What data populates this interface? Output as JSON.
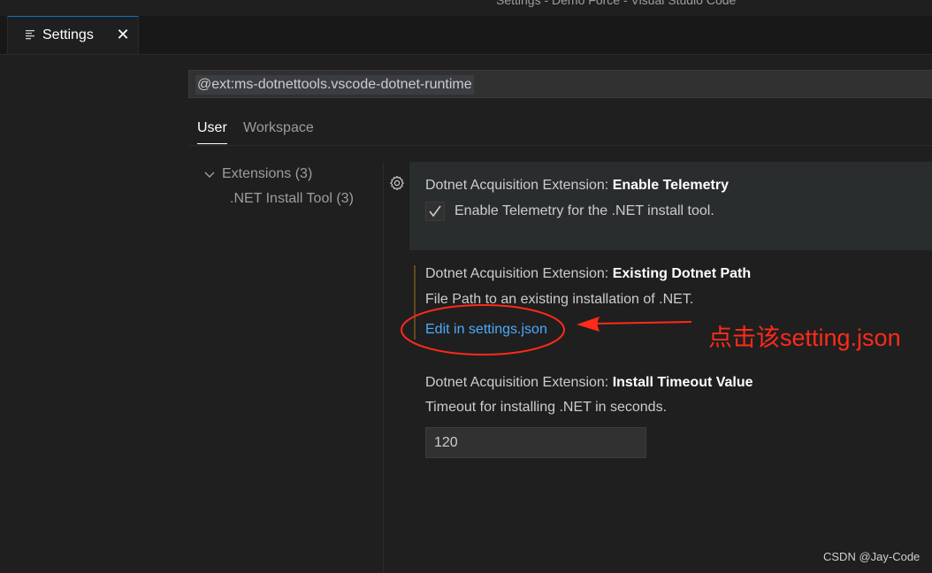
{
  "window": {
    "title": "Settings - Demo Force - Visual Studio Code"
  },
  "tab": {
    "icon": "settings-editor-icon",
    "label": "Settings",
    "close_icon": "close-icon"
  },
  "search": {
    "query": "@ext:ms-dotnettools.vscode-dotnet-runtime"
  },
  "scope_tabs": [
    {
      "label": "User",
      "active": true
    },
    {
      "label": "Workspace",
      "active": false
    }
  ],
  "toc": {
    "group": "Extensions (3)",
    "child": ".NET Install Tool (3)",
    "chevron_icon": "chevron-down-icon"
  },
  "settings": [
    {
      "category": "Dotnet Acquisition Extension: ",
      "name": "Enable Telemetry",
      "description": "Enable Telemetry for the .NET install tool.",
      "checked": true
    },
    {
      "category": "Dotnet Acquisition Extension: ",
      "name": "Existing Dotnet Path",
      "description": "File Path to an existing installation of .NET.",
      "link": "Edit in settings.json",
      "modified": true
    },
    {
      "category": "Dotnet Acquisition Extension: ",
      "name": "Install Timeout Value",
      "description": "Timeout for installing .NET in seconds.",
      "value": "120"
    }
  ],
  "annotation": {
    "text": "点击该setting.json",
    "color": "#ff2a1a"
  },
  "watermark": "CSDN @Jay-Code",
  "colors": {
    "background": "#1f1f1f",
    "link": "#4daafc",
    "accent": "#0078d4"
  }
}
